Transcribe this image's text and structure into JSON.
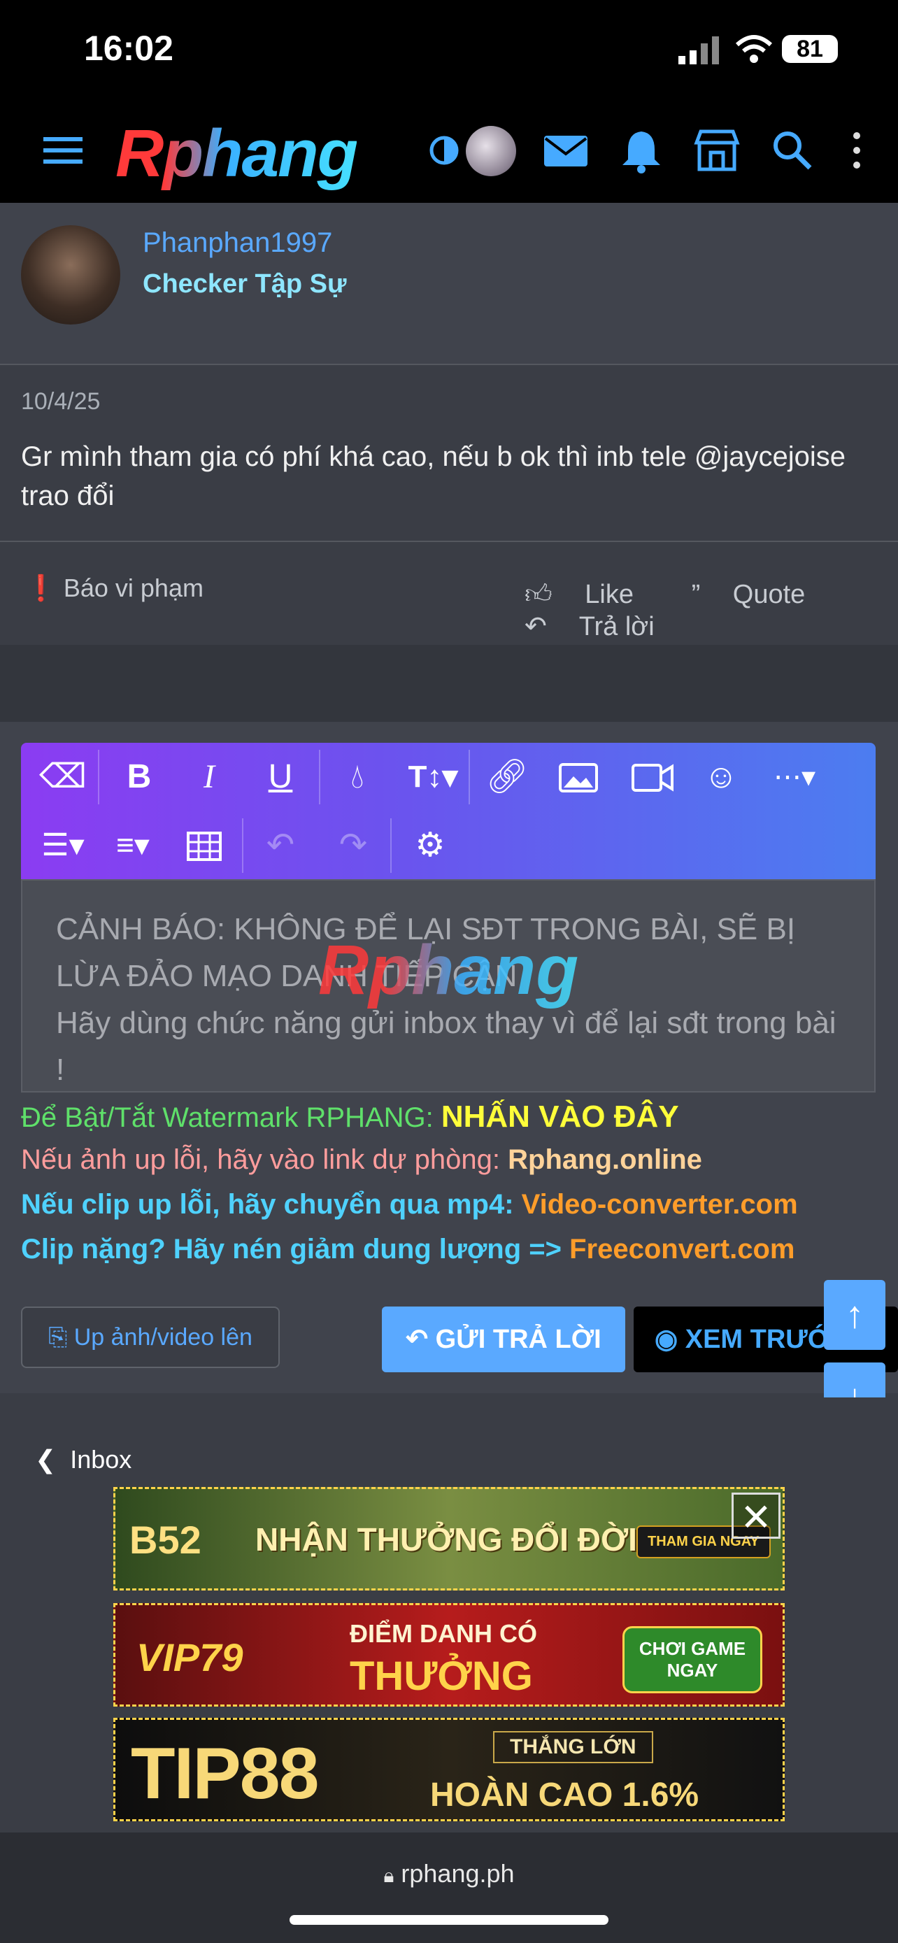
{
  "status": {
    "time": "16:02",
    "battery": "81"
  },
  "header": {
    "logo": "Rphang",
    "icons": [
      "menu-icon",
      "theme-toggle-icon",
      "avatar",
      "mail-icon",
      "bell-icon",
      "store-icon",
      "search-icon",
      "more-vertical-icon"
    ]
  },
  "post": {
    "username": "Phanphan1997",
    "user_title": "Checker Tập Sự",
    "date": "10/4/25",
    "body": "Gr mình tham gia có phí khá cao, nếu b ok thì inb tele @jaycejoise trao đổi",
    "report_label": "Báo vi phạm",
    "like_label": "Like",
    "quote_label": "Quote",
    "reply_label": "Trả lời"
  },
  "editor": {
    "placeholder_line1": "CẢNH BÁO: KHÔNG ĐỂ LẠI SĐT TRONG BÀI, SẼ BỊ LỪA ĐẢO MẠO DANH TIẾP CẬN",
    "placeholder_line2": "Hãy dùng chức năng gửi inbox thay vì để lại sđt trong bài !",
    "watermark": "Rphang"
  },
  "notes": {
    "n1_text": "Để Bật/Tắt Watermark RPHANG: ",
    "n1_link": "NHẤN VÀO ĐÂY",
    "n2_text": "Nếu ảnh up lỗi, hãy vào link dự phòng: ",
    "n2_link": "Rphang.online",
    "n3_text": "Nếu clip up lỗi, hãy chuyển qua mp4: ",
    "n3_link": "Video-converter.com",
    "n4_text": "Clip nặng? Hãy nén giảm dung lượng => ",
    "n4_link": "Freeconvert.com"
  },
  "buttons": {
    "upload": "Up ảnh/video lên",
    "submit_reply": "GỬI TRẢ LỜI",
    "preview": "XEM TRƯỚC"
  },
  "nav": {
    "inbox": "Inbox"
  },
  "ads": {
    "ad1_brand": "B52",
    "ad1_text": "NHẬN THƯỞNG ĐỔI ĐỜI",
    "ad1_cta": "THAM GIA NGAY",
    "ad2_brand": "VIP79",
    "ad2_text1": "ĐIỂM DANH CÓ",
    "ad2_text2": "THƯỞNG",
    "ad2_cta": "CHƠI GAME NGAY",
    "ad3_brand": "TIP88",
    "ad3_text1": "THẮNG LỚN",
    "ad3_text2": "HOÀN CAO 1.6%"
  },
  "browser": {
    "url": "rphang.ph"
  },
  "colors": {
    "accent": "#5aa9ff",
    "note_green": "#5fe06a",
    "note_yellow": "#ffff3a",
    "note_pink": "#ff9d9d",
    "note_cyan": "#4fd2ff",
    "note_orange": "#ff9d2a"
  }
}
